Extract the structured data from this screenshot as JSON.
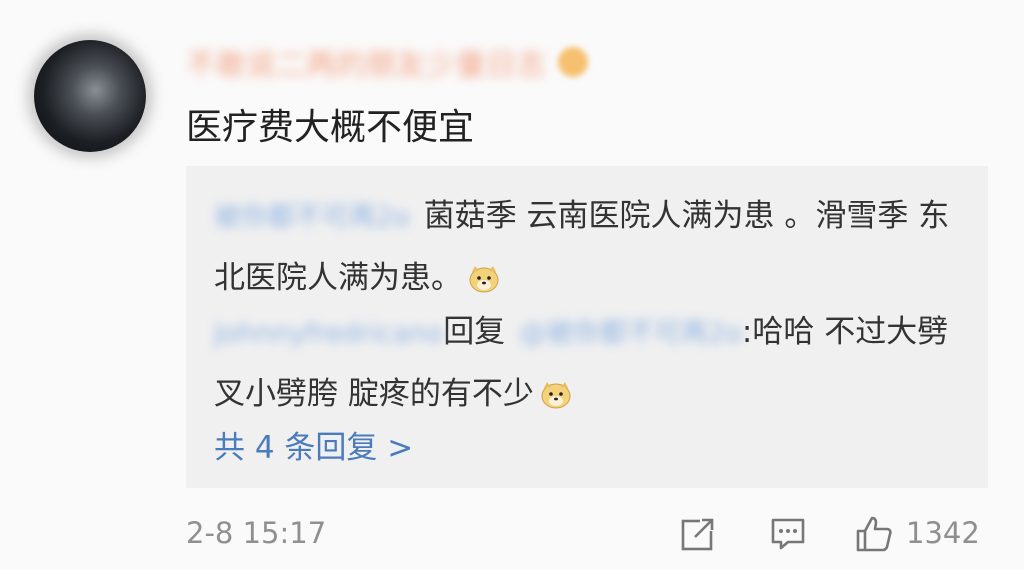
{
  "comment": {
    "username_blurred": "不敢说二两的朋友少量日志",
    "text": "医疗费大概不便宜",
    "timestamp": "2-8 15:17",
    "like_count": "1342"
  },
  "replies": [
    {
      "author_blurred": "被你都不可再2o",
      "text_line": "菌菇季 云南医院人满为患 。滑雪季 东北医院人满为患。",
      "emoji": "doge-emoji"
    },
    {
      "author_blurred": "Johnnyfredricano",
      "reply_word": "回复",
      "target_blurred": "@被你都不可再2o",
      "text": ":哈哈 不过大劈叉小劈胯 腚疼的有不少",
      "emoji": "doge-emoji"
    }
  ],
  "more_replies_label": "共 4 条回复 >",
  "colors": {
    "background": "#fafafa",
    "reply_box": "#f0f0f0",
    "link_blue": "#4a7bbd",
    "meta_gray": "#8f8f8f"
  }
}
